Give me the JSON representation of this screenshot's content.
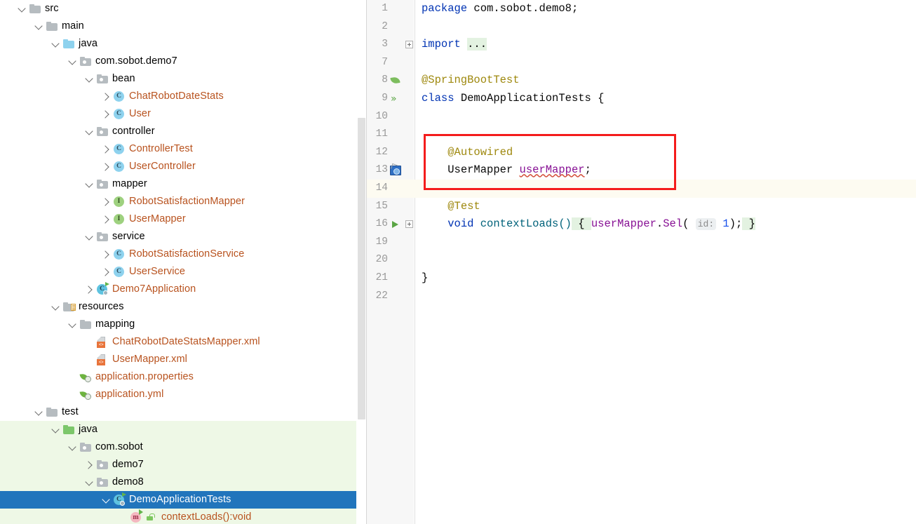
{
  "project_tree": {
    "rows": [
      {
        "label": "src",
        "indent": 1,
        "arrow": "open",
        "icon": "folder",
        "color": "plain"
      },
      {
        "label": "main",
        "indent": 2,
        "arrow": "open",
        "icon": "folder",
        "color": "plain"
      },
      {
        "label": "java",
        "indent": 3,
        "arrow": "open",
        "icon": "folder-blue",
        "color": "plain"
      },
      {
        "label": "com.sobot.demo7",
        "indent": 4,
        "arrow": "open",
        "icon": "package",
        "color": "plain"
      },
      {
        "label": "bean",
        "indent": 5,
        "arrow": "open",
        "icon": "package",
        "color": "plain"
      },
      {
        "label": "ChatRobotDateStats",
        "indent": 6,
        "arrow": "closed",
        "icon": "class",
        "color": "orange"
      },
      {
        "label": "User",
        "indent": 6,
        "arrow": "closed",
        "icon": "class",
        "color": "orange"
      },
      {
        "label": "controller",
        "indent": 5,
        "arrow": "open",
        "icon": "package",
        "color": "plain"
      },
      {
        "label": "ControllerTest",
        "indent": 6,
        "arrow": "closed",
        "icon": "class",
        "color": "orange"
      },
      {
        "label": "UserController",
        "indent": 6,
        "arrow": "closed",
        "icon": "class",
        "color": "orange"
      },
      {
        "label": "mapper",
        "indent": 5,
        "arrow": "open",
        "icon": "package",
        "color": "plain"
      },
      {
        "label": "RobotSatisfactionMapper",
        "indent": 6,
        "arrow": "closed",
        "icon": "interface",
        "color": "orange"
      },
      {
        "label": "UserMapper",
        "indent": 6,
        "arrow": "closed",
        "icon": "interface",
        "color": "orange"
      },
      {
        "label": "service",
        "indent": 5,
        "arrow": "open",
        "icon": "package",
        "color": "plain"
      },
      {
        "label": "RobotSatisfactionService",
        "indent": 6,
        "arrow": "closed",
        "icon": "class",
        "color": "orange"
      },
      {
        "label": "UserService",
        "indent": 6,
        "arrow": "closed",
        "icon": "class",
        "color": "orange"
      },
      {
        "label": "Demo7Application",
        "indent": 5,
        "arrow": "closed",
        "icon": "springapp",
        "color": "orange"
      },
      {
        "label": "resources",
        "indent": 3,
        "arrow": "open",
        "icon": "resources",
        "color": "plain"
      },
      {
        "label": "mapping",
        "indent": 4,
        "arrow": "open",
        "icon": "folder",
        "color": "plain"
      },
      {
        "label": "ChatRobotDateStatsMapper.xml",
        "indent": 5,
        "arrow": "none",
        "icon": "xml",
        "color": "orange"
      },
      {
        "label": "UserMapper.xml",
        "indent": 5,
        "arrow": "none",
        "icon": "xml",
        "color": "orange"
      },
      {
        "label": "application.properties",
        "indent": 4,
        "arrow": "none",
        "icon": "springleaf",
        "color": "orange"
      },
      {
        "label": "application.yml",
        "indent": 4,
        "arrow": "none",
        "icon": "springleaf",
        "color": "orange"
      },
      {
        "label": "test",
        "indent": 2,
        "arrow": "open",
        "icon": "folder",
        "color": "plain"
      },
      {
        "label": "java",
        "indent": 3,
        "arrow": "open",
        "icon": "folder-green",
        "color": "plain",
        "scope": "test"
      },
      {
        "label": "com.sobot",
        "indent": 4,
        "arrow": "open",
        "icon": "package",
        "color": "plain",
        "scope": "test"
      },
      {
        "label": "demo7",
        "indent": 5,
        "arrow": "closed",
        "icon": "package",
        "color": "plain",
        "scope": "test"
      },
      {
        "label": "demo8",
        "indent": 5,
        "arrow": "open",
        "icon": "package",
        "color": "plain",
        "scope": "test"
      },
      {
        "label": "DemoApplicationTests",
        "indent": 6,
        "arrow": "open",
        "icon": "springapp",
        "color": "plain",
        "scope": "selected"
      },
      {
        "label": "contextLoads():void",
        "indent": 7,
        "arrow": "none",
        "icon": "method",
        "color": "orange",
        "scope": "test"
      }
    ]
  },
  "editor": {
    "lines": [
      {
        "num": "1",
        "gutter": "",
        "fold": "",
        "current": false
      },
      {
        "num": "2",
        "gutter": "",
        "fold": "",
        "current": false
      },
      {
        "num": "3",
        "gutter": "",
        "fold": "plus",
        "current": false
      },
      {
        "num": "7",
        "gutter": "",
        "fold": "",
        "current": false
      },
      {
        "num": "8",
        "gutter": "leaf",
        "fold": "",
        "current": false
      },
      {
        "num": "9",
        "gutter": "runall",
        "fold": "",
        "current": false
      },
      {
        "num": "10",
        "gutter": "",
        "fold": "",
        "current": false
      },
      {
        "num": "11",
        "gutter": "",
        "fold": "",
        "current": false
      },
      {
        "num": "12",
        "gutter": "",
        "fold": "",
        "current": false
      },
      {
        "num": "13",
        "gutter": "bean",
        "fold": "",
        "current": false
      },
      {
        "num": "14",
        "gutter": "",
        "fold": "",
        "current": true
      },
      {
        "num": "15",
        "gutter": "",
        "fold": "",
        "current": false
      },
      {
        "num": "16",
        "gutter": "run",
        "fold": "plus",
        "current": false
      },
      {
        "num": "19",
        "gutter": "",
        "fold": "",
        "current": false
      },
      {
        "num": "20",
        "gutter": "",
        "fold": "",
        "current": false
      },
      {
        "num": "21",
        "gutter": "",
        "fold": "",
        "current": false
      },
      {
        "num": "22",
        "gutter": "",
        "fold": "",
        "current": false
      }
    ],
    "code": {
      "l1_kw": "package",
      "l1_pkg": " com.sobot.demo8;",
      "l3_kw": "import",
      "l3_ellipsis": "...",
      "l8_anno": "@SpringBootTest",
      "l9_kw": "class",
      "l9_name": " DemoApplicationTests {",
      "l12_anno": "@Autowired",
      "l13_type": "UserMapper ",
      "l13_field": "userMapper",
      "l13_semi": ";",
      "l15_anno": "@Test",
      "l16_kw": "void",
      "l16_mth": " contextLoads()",
      "l16_open": " { ",
      "l16_recv": "userMapper",
      "l16_dot": ".",
      "l16_call": "Sel",
      "l16_paren": "( ",
      "l16_hint": "id:",
      "l16_arg": "1",
      "l16_tail": ");",
      "l16_close": " }",
      "l21_close": "}"
    }
  },
  "annotation": {
    "highlight_color": "#f41c1c",
    "selected_row_color": "#2175bc",
    "test_scope_color": "#eef8e6",
    "current_line_color": "#fdfbf1"
  }
}
